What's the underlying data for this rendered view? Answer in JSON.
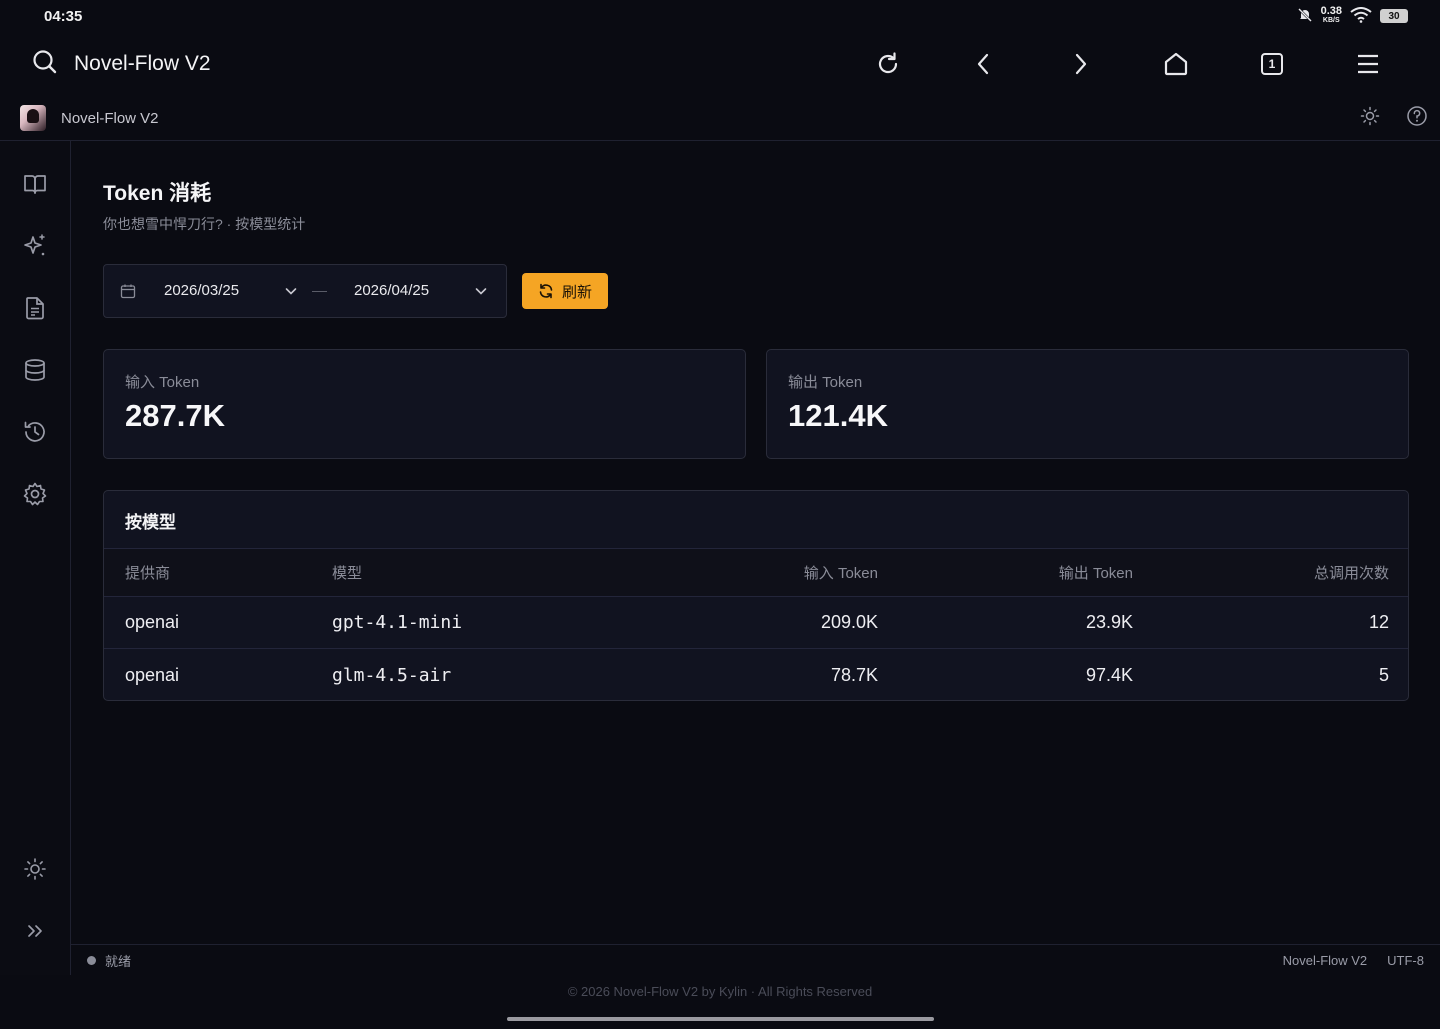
{
  "status_bar": {
    "time": "04:35",
    "net_speed": "0.38",
    "net_unit": "KB/S",
    "battery": "30"
  },
  "browser": {
    "title": "Novel-Flow V2",
    "tab_count": "1"
  },
  "app": {
    "title": "Novel-Flow V2"
  },
  "page": {
    "title": "Token 消耗",
    "subtitle": "你也想雪中悍刀行? · 按模型统计"
  },
  "filter": {
    "start_date": "2026/03/25",
    "end_date": "2026/04/25",
    "refresh_label": "刷新"
  },
  "summary": {
    "input_label": "输入 Token",
    "input_value": "287.7K",
    "output_label": "输出 Token",
    "output_value": "121.4K"
  },
  "table": {
    "title": "按模型",
    "headers": {
      "provider": "提供商",
      "model": "模型",
      "input": "输入 Token",
      "output": "输出 Token",
      "calls": "总调用次数"
    },
    "rows": [
      {
        "provider": "openai",
        "model": "gpt-4.1-mini",
        "input": "209.0K",
        "output": "23.9K",
        "calls": "12"
      },
      {
        "provider": "openai",
        "model": "glm-4.5-air",
        "input": "78.7K",
        "output": "97.4K",
        "calls": "5"
      }
    ]
  },
  "footer_status": {
    "state": "就绪",
    "app_name": "Novel-Flow V2",
    "encoding": "UTF-8"
  },
  "copyright": "© 2026 Novel-Flow V2 by Kylin · All Rights Reserved",
  "colors": {
    "background": "#0a0b12",
    "accent": "#f5a524",
    "card": "#111320",
    "border": "#2a2c3a"
  }
}
